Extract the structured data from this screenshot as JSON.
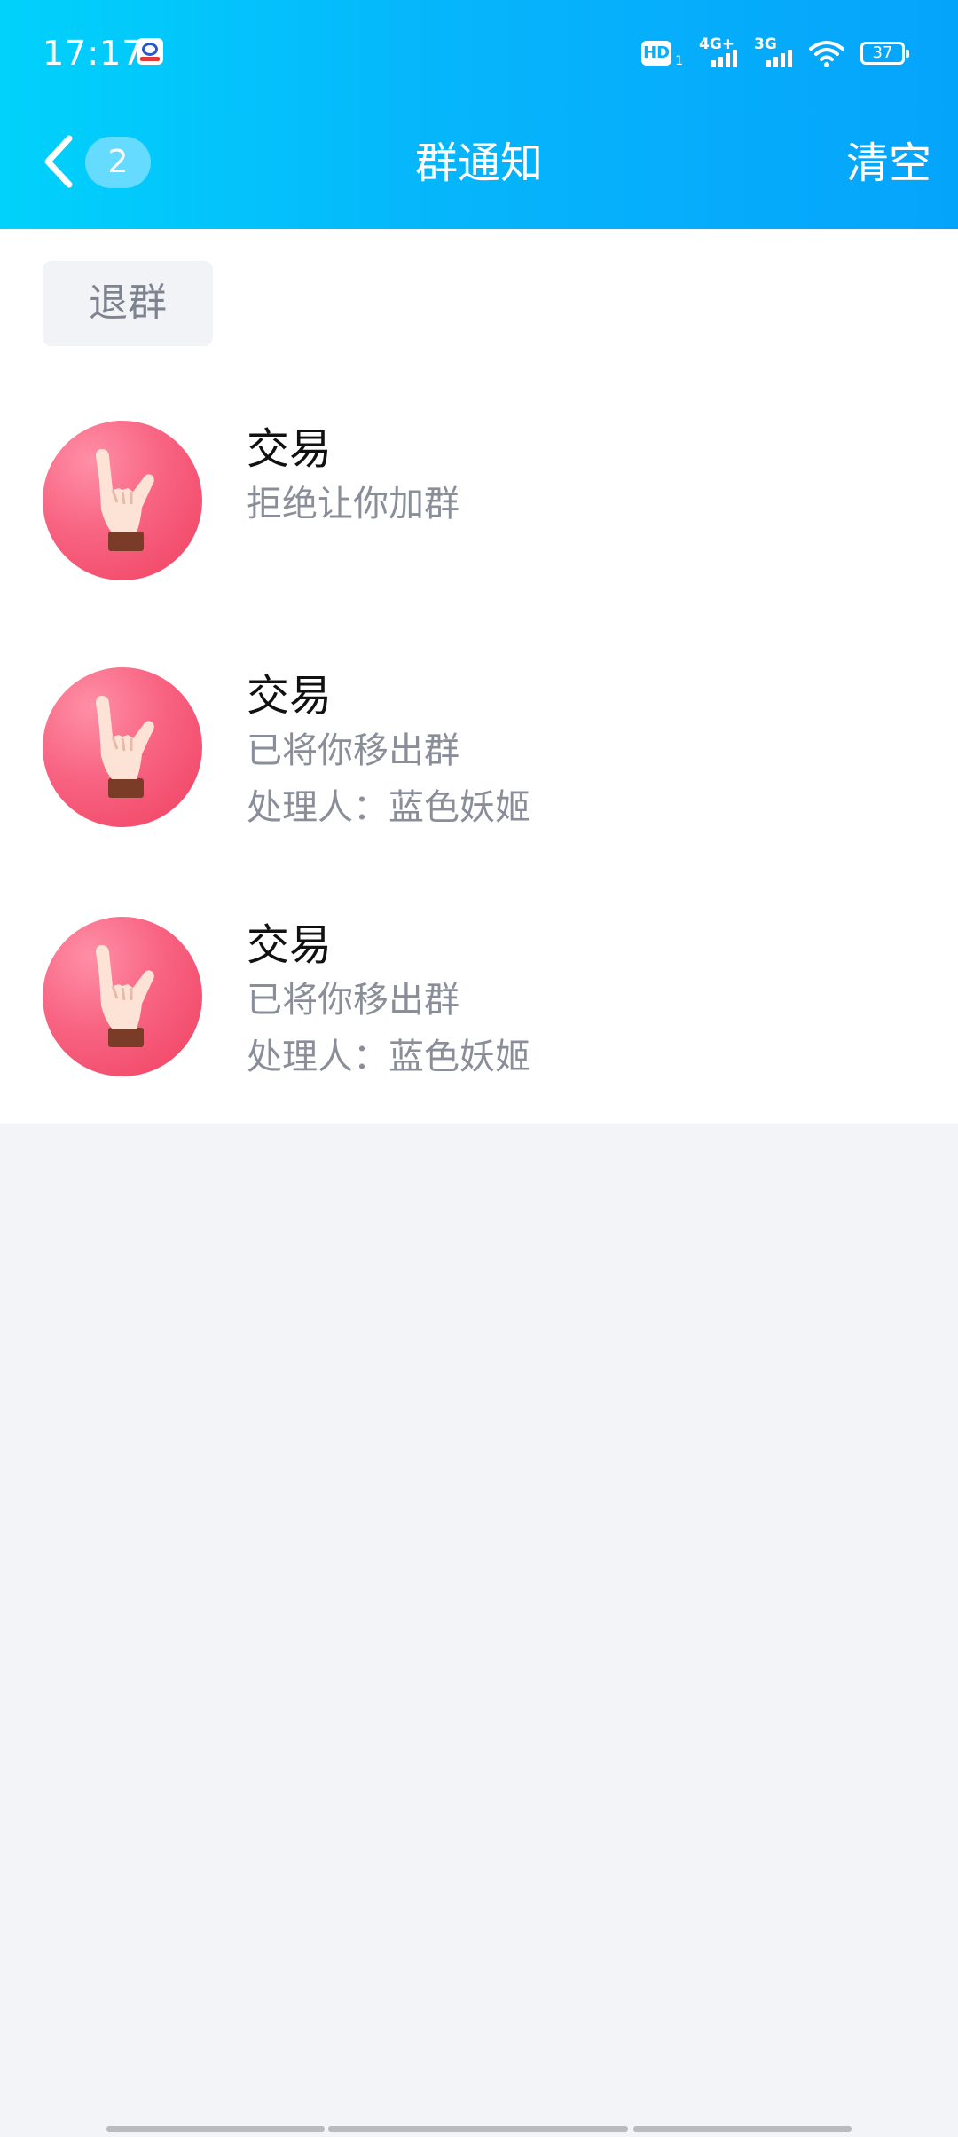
{
  "status_bar": {
    "time": "17:17",
    "hd_label": "HD",
    "hd_sub": "1",
    "net1": "4G+",
    "net2": "3G",
    "battery": "37"
  },
  "header": {
    "back_badge": "2",
    "title": "群通知",
    "clear_label": "清空"
  },
  "filter": {
    "label": "退群"
  },
  "notices": [
    {
      "name": "交易",
      "action": "拒绝让你加群"
    },
    {
      "name": "交易",
      "action": "已将你移出群",
      "handler": "处理人：蓝色妖姬"
    },
    {
      "name": "交易",
      "action": "已将你移出群",
      "handler": "处理人：蓝色妖姬"
    }
  ],
  "colors": {
    "header_start": "#00d2fb",
    "header_end": "#05a4fb",
    "avatar_pink": "#f86382",
    "background": "#f3f4f8"
  },
  "icons": {
    "back": "chevron-left-icon",
    "avatar": "rock-hand-icon"
  }
}
